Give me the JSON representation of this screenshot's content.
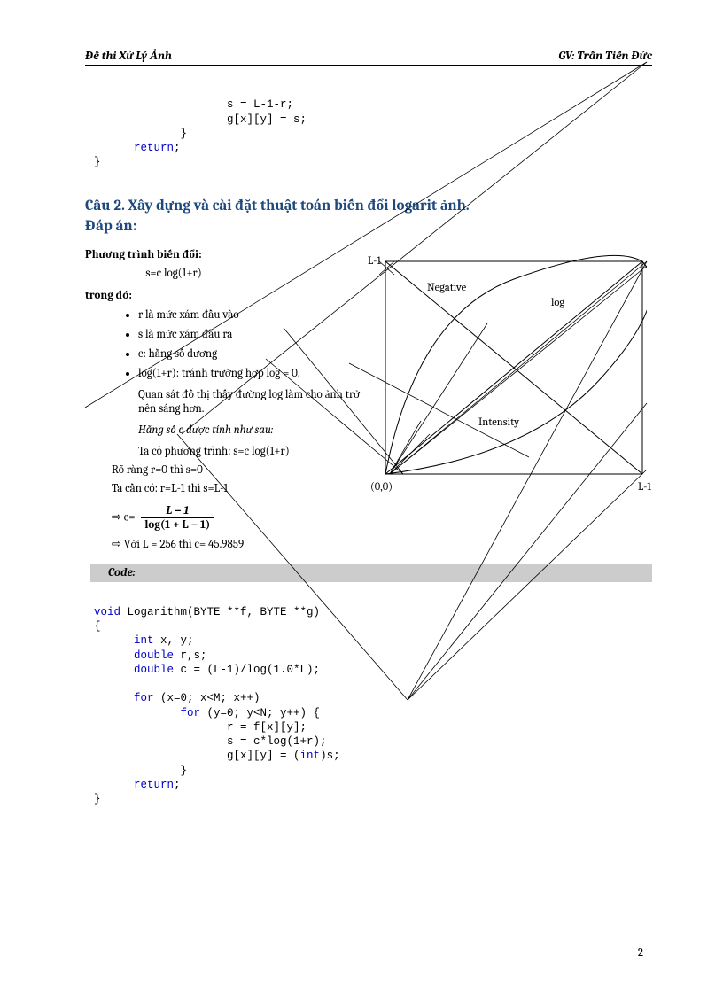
{
  "header": {
    "left": "Đề thi Xử Lý Ảnh",
    "right": "GV: Trần Tiến Đức"
  },
  "code1": {
    "l1": "                    s = L-1-r;",
    "l2": "                    g[x][y] = s;",
    "l3": "             }",
    "l4_kw": "      return",
    "l4_b": ";",
    "l5": "}"
  },
  "h2_q": "Câu 2. Xây dựng và cài đặt thuật toán biến đổi logarit ảnh.",
  "h2_a": "Đáp án:",
  "p_eq_intro": "Phương trình biến đổi:",
  "p_eq": "s=c log(1+r)",
  "p_where": "trong đó:",
  "bullets": {
    "b1": "r là mức xám đầu vào",
    "b2": "s là mức xám đầu ra",
    "b3": "c: hằng số dương",
    "b4": "log(1+r): tránh trường hợp log = 0."
  },
  "p_obs": "Quan sát đồ thị thấy đường log làm cho ảnh trở nên sáng hơn.",
  "p_const": "Hằng số c được tính như sau:",
  "p_tacoeq": "Ta có phương trình: s=c log(1+r)",
  "p_obv": "Rõ ràng r=0 thì s=0",
  "p_need": "Ta cần có: r=L-1 thì s=L-1",
  "frac": {
    "pre": "c=",
    "num": "L − 1",
    "den": "log(1 + L − 1)"
  },
  "p_withL": "Với L = 256 thì c= 45.9859",
  "arrow": "⇨",
  "code_label": "Code:",
  "code2": {
    "l1a": "void",
    "l1b": " Logarithm(BYTE **f, BYTE **g)",
    "l2": "{",
    "l3a": "      int",
    "l3b": " x, y;",
    "l4a": "      double",
    "l4b": " r,s;",
    "l5a": "      double",
    "l5b": " c = (L-1)/log(1.0*L);",
    "blank": "",
    "l6a": "      for",
    "l6b": " (x=0; x<M; x++)",
    "l7a": "             for",
    "l7b": " (y=0; y<N; y++) {",
    "l8": "                    r = f[x][y];",
    "l9": "                    s = c*log(1+r);",
    "l10a": "                    g[x][y] = (",
    "l10b": "int",
    "l10c": ")s;",
    "l11": "             }",
    "l12a": "      return",
    "l12b": ";",
    "l13": "}"
  },
  "pagenum": "2",
  "chart_data": {
    "type": "line",
    "xlabel": "(0,0)",
    "ylabel_tl": "L-1",
    "xlabel_br": "L-1",
    "series": [
      {
        "name": "Negative",
        "label": "Negative"
      },
      {
        "name": "log",
        "label": "log"
      },
      {
        "name": "Intensity",
        "label": "Intensity"
      }
    ],
    "xlim": [
      0,
      255
    ],
    "ylim": [
      0,
      255
    ]
  }
}
